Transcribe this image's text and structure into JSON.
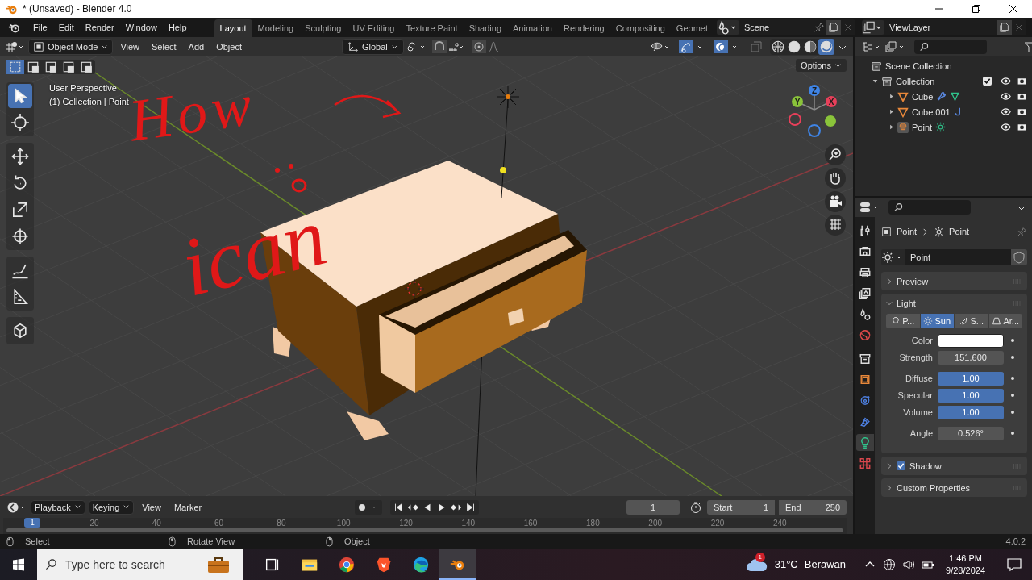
{
  "title_bar": {
    "title": "* (Unsaved) - Blender 4.0"
  },
  "menu": [
    "File",
    "Edit",
    "Render",
    "Window",
    "Help"
  ],
  "workspaces": [
    {
      "label": "Layout",
      "selected": true
    },
    {
      "label": "Modeling",
      "selected": false
    },
    {
      "label": "Sculpting",
      "selected": false
    },
    {
      "label": "UV Editing",
      "selected": false
    },
    {
      "label": "Texture Paint",
      "selected": false
    },
    {
      "label": "Shading",
      "selected": false
    },
    {
      "label": "Animation",
      "selected": false
    },
    {
      "label": "Rendering",
      "selected": false
    },
    {
      "label": "Compositing",
      "selected": false
    },
    {
      "label": "Geomet",
      "selected": false
    }
  ],
  "scene": {
    "value": "Scene"
  },
  "view_layer": {
    "value": "ViewLayer"
  },
  "viewport": {
    "mode": "Object Mode",
    "menus": [
      "View",
      "Select",
      "Add",
      "Object"
    ],
    "orientation": "Global",
    "shading": [
      {
        "selected": false
      },
      {
        "selected": false
      },
      {
        "selected": false
      },
      {
        "selected": true
      }
    ],
    "select_modes": [
      {
        "selected": true
      },
      {
        "selected": false
      },
      {
        "selected": false
      },
      {
        "selected": false
      },
      {
        "selected": false
      }
    ],
    "options": "Options",
    "overlay_lines": [
      "User Perspective",
      "(1) Collection | Point"
    ],
    "annotations": [
      "How",
      "ican"
    ],
    "tools": [
      [
        {
          "kind": "select",
          "selected": true
        },
        {
          "kind": "cursor",
          "selected": false
        }
      ],
      [
        {
          "kind": "move",
          "selected": false
        },
        {
          "kind": "rotate",
          "selected": false
        },
        {
          "kind": "scale",
          "selected": false
        },
        {
          "kind": "transform",
          "selected": false
        }
      ],
      [
        {
          "kind": "annotate",
          "selected": false
        },
        {
          "kind": "measure",
          "selected": false
        }
      ],
      [
        {
          "kind": "add-cube",
          "selected": false
        }
      ]
    ],
    "gizmo": [
      {
        "label": "Z",
        "color": "#3f84e5"
      },
      {
        "label": "Y",
        "color": "#8ac43a"
      },
      {
        "label": "X",
        "color": "#e8405a"
      }
    ]
  },
  "outliner": {
    "root": "Scene Collection",
    "collection": {
      "name": "Collection",
      "expanded": true,
      "checked": true,
      "children": [
        {
          "name": "Cube",
          "kind": "mesh",
          "expanded": false,
          "extras": [
            {
              "kind": "modifier"
            },
            {
              "kind": "vertex-group"
            }
          ]
        },
        {
          "name": "Cube.001",
          "kind": "mesh",
          "expanded": false,
          "extras": [
            {
              "kind": "hook"
            }
          ]
        },
        {
          "name": "Point",
          "kind": "light",
          "expanded": false,
          "extras": [
            {
              "kind": "sun"
            }
          ]
        }
      ]
    }
  },
  "properties": {
    "tabs": [
      [
        {
          "kind": "tool",
          "selected": false
        },
        {
          "kind": "render",
          "selected": false
        },
        {
          "kind": "output",
          "selected": false
        },
        {
          "kind": "view-layer",
          "selected": false
        },
        {
          "kind": "scene",
          "selected": false
        },
        {
          "kind": "world",
          "selected": false
        }
      ],
      [
        {
          "kind": "collection",
          "selected": false
        },
        {
          "kind": "object",
          "selected": false
        },
        {
          "kind": "physics",
          "selected": false
        },
        {
          "kind": "constraints",
          "selected": false
        },
        {
          "kind": "data",
          "selected": true
        },
        {
          "kind": "texture",
          "selected": false
        }
      ]
    ],
    "breadcrumb": [
      "Point",
      "Point"
    ],
    "data_name": "Point",
    "panels": [
      {
        "title": "Preview",
        "expanded": false,
        "kind": "plain"
      },
      {
        "title": "Light",
        "expanded": true,
        "kind": "light"
      },
      {
        "title": "Shadow",
        "expanded": false,
        "kind": "checkbox",
        "checked": true
      },
      {
        "title": "Custom Properties",
        "expanded": false,
        "kind": "plain"
      }
    ],
    "light_types": [
      {
        "label": "P...",
        "selected": false
      },
      {
        "label": "Sun",
        "selected": true
      },
      {
        "label": "S...",
        "selected": false
      },
      {
        "label": "Ar...",
        "selected": false
      }
    ],
    "field_groups": [
      [
        {
          "label": "Color",
          "kind": "color",
          "color": "#ffffff"
        },
        {
          "label": "Strength",
          "kind": "number",
          "value": "151.600"
        }
      ],
      [
        {
          "label": "Diffuse",
          "kind": "factor",
          "value": "1.00",
          "level": 1
        },
        {
          "label": "Specular",
          "kind": "factor",
          "value": "1.00",
          "level": 1
        },
        {
          "label": "Volume",
          "kind": "factor",
          "value": "1.00",
          "level": 1
        }
      ],
      [
        {
          "label": "Angle",
          "kind": "number",
          "value": "0.526°"
        }
      ]
    ]
  },
  "timeline": {
    "menus": [
      {
        "label": "Playback",
        "dropdown": true
      },
      {
        "label": "Keying",
        "dropdown": true
      },
      {
        "label": "View",
        "dropdown": false
      },
      {
        "label": "Marker",
        "dropdown": false
      }
    ],
    "current_frame": "1",
    "start": {
      "label": "Start",
      "value": "1"
    },
    "end": {
      "label": "End",
      "value": "250"
    },
    "ruler_current": "1",
    "ruler_ticks": [
      "20",
      "40",
      "60",
      "80",
      "100",
      "120",
      "140",
      "160",
      "180",
      "200",
      "220",
      "240"
    ]
  },
  "status_bar": {
    "hints": [
      "Select",
      "Rotate View",
      "Object"
    ],
    "version": "4.0.2"
  },
  "taskbar": {
    "search_placeholder": "Type here to search",
    "apps": [
      {
        "kind": "task-view",
        "selected": false
      },
      {
        "kind": "explorer",
        "selected": false
      },
      {
        "kind": "chrome",
        "selected": false
      },
      {
        "kind": "brave",
        "selected": false
      },
      {
        "kind": "edge",
        "selected": false
      },
      {
        "kind": "blender",
        "selected": true
      }
    ],
    "weather": {
      "badge": "1",
      "temperature": "31°C",
      "condition": "Berawan"
    },
    "time": "1:46 PM",
    "date": "9/28/2024"
  }
}
